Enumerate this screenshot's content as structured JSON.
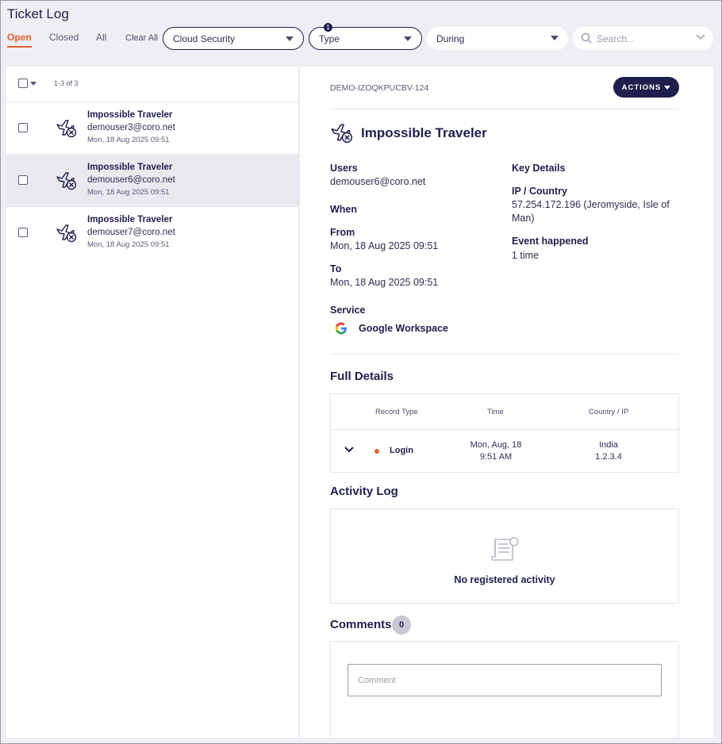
{
  "page": {
    "title": "Ticket Log"
  },
  "tabs": [
    {
      "label": "Open",
      "active": true
    },
    {
      "label": "Closed",
      "active": false
    },
    {
      "label": "All",
      "active": false
    }
  ],
  "filters": {
    "clear_all": "Clear All",
    "module": "Cloud Security",
    "type": "Type",
    "type_badge": "1",
    "period": "During",
    "search_placeholder": "Search..."
  },
  "list": {
    "count_text": "1-3 of 3",
    "items": [
      {
        "title": "Impossible Traveler",
        "user": "demouser3@coro.net",
        "time": "Mon, 18 Aug 2025 09:51",
        "selected": false
      },
      {
        "title": "Impossible Traveler",
        "user": "demouser6@coro.net",
        "time": "Mon, 18 Aug 2025 09:51",
        "selected": true
      },
      {
        "title": "Impossible Traveler",
        "user": "demouser7@coro.net",
        "time": "Mon, 18 Aug 2025 09:51",
        "selected": false
      }
    ]
  },
  "detail": {
    "ticket_id": "DEMO-IZOQKPUCBV-124",
    "actions_label": "ACTIONS",
    "title": "Impossible Traveler",
    "users_label": "Users",
    "users_value": "demouser6@coro.net",
    "when_label": "When",
    "from_label": "From",
    "from_value": "Mon, 18 Aug 2025 09:51",
    "to_label": "To",
    "to_value": "Mon, 18 Aug 2025 09:51",
    "service_label": "Service",
    "service_value": "Google Workspace",
    "key_details_label": "Key Details",
    "ip_country_label": "IP / Country",
    "ip_country_value": "57.254.172.196 (Jeromyside, Isle of Man)",
    "event_label": "Event happened",
    "event_value": "1 time",
    "full_details_title": "Full Details",
    "table": {
      "headers": [
        "Record Type",
        "Time",
        "Country / IP"
      ],
      "row": {
        "type": "Login",
        "time_line1": "Mon, Aug, 18",
        "time_line2": "9:51 AM",
        "country": "India",
        "ip": "1.2.3.4"
      }
    },
    "activity_title": "Activity Log",
    "no_activity": "No registered activity",
    "comments_title": "Comments",
    "comments_count": "0",
    "comment_placeholder": "Comment"
  },
  "colors": {
    "primary": "#1f1f4d",
    "accent": "#e0612c",
    "background": "#eeeef4"
  }
}
